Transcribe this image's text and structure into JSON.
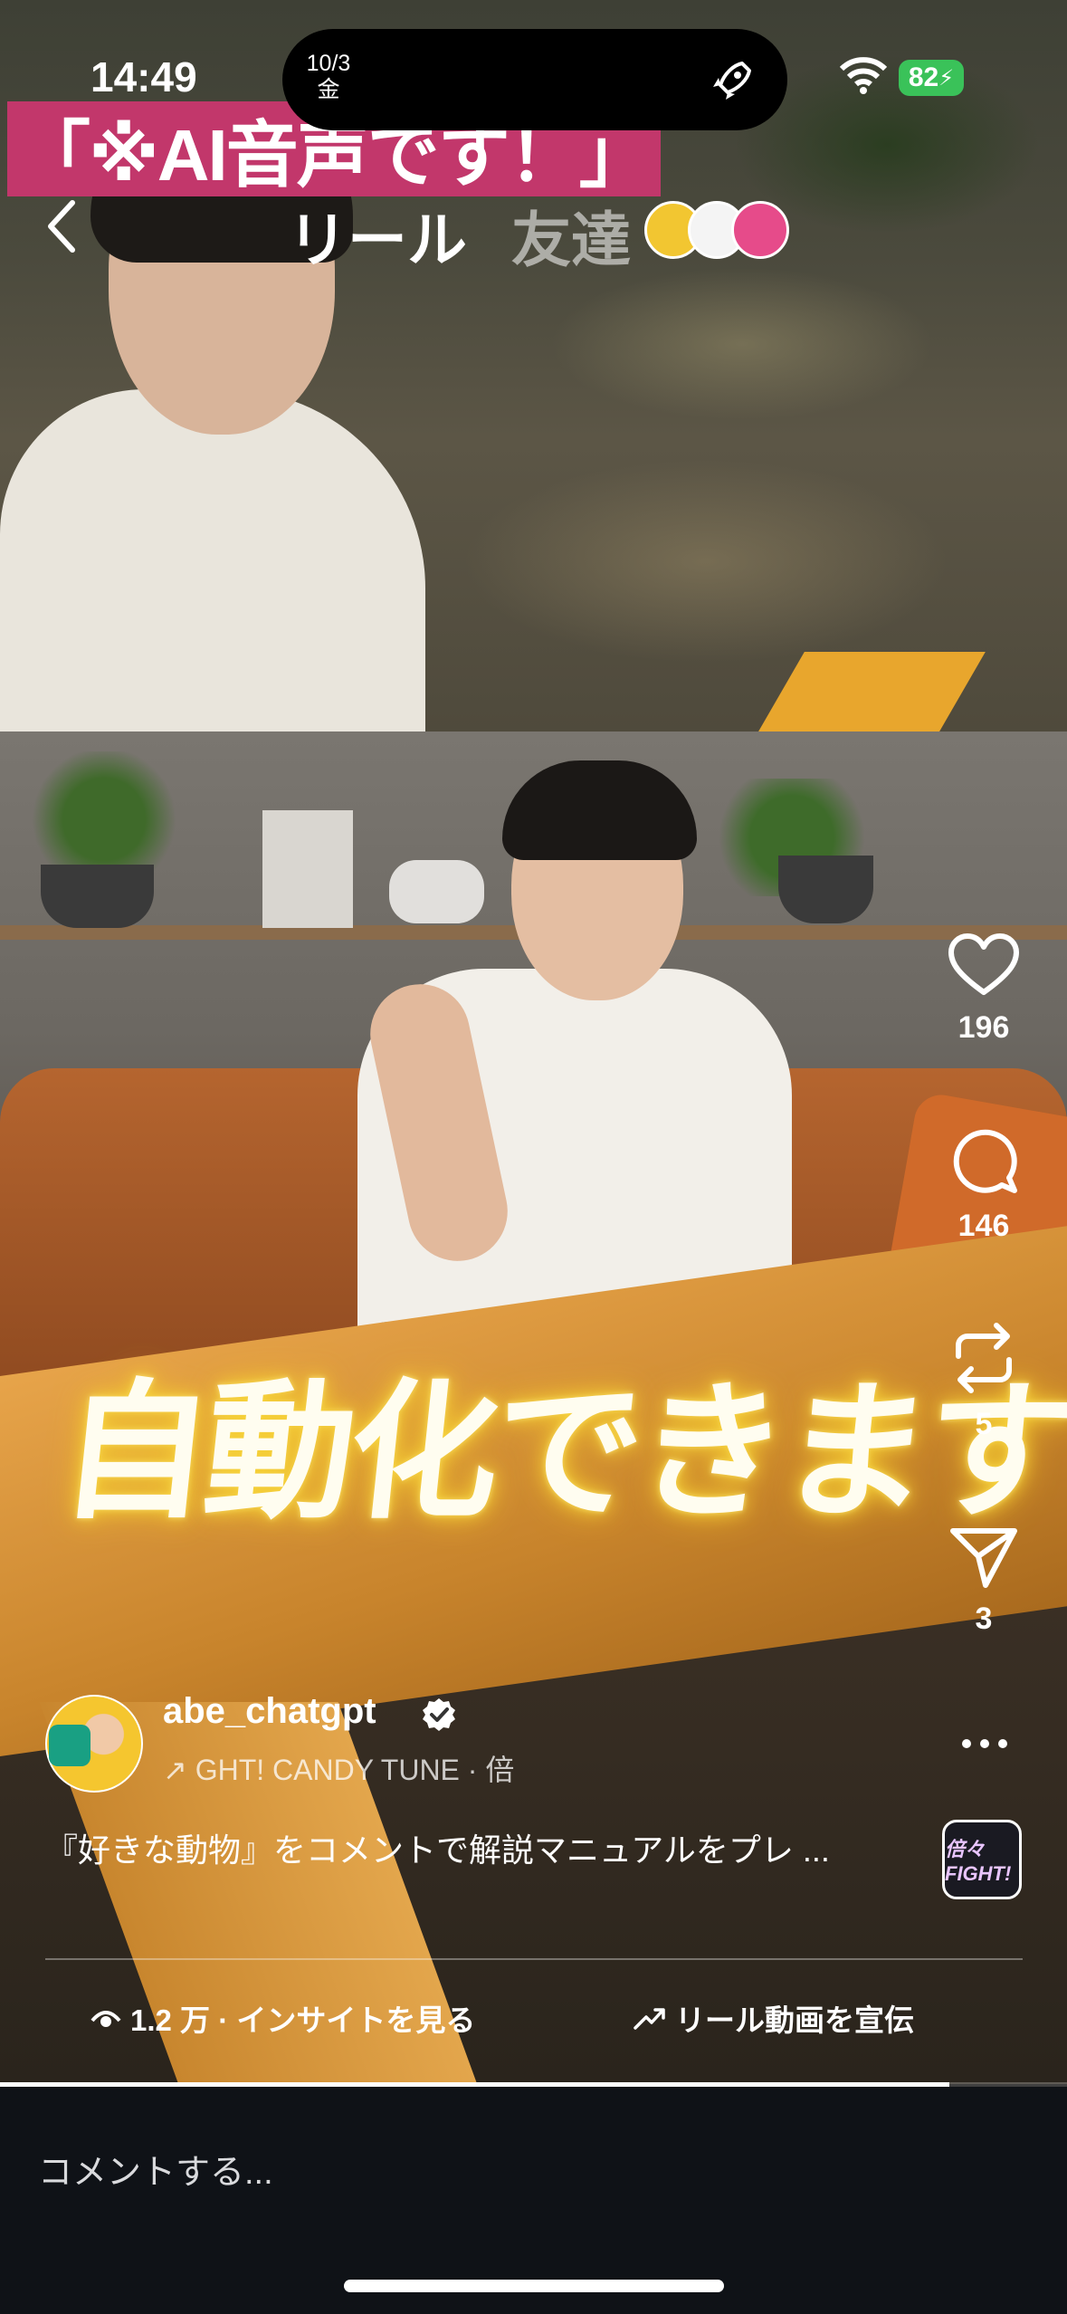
{
  "status_bar": {
    "time": "14:49",
    "date_day": "10/3",
    "date_weekday": "金",
    "battery": "82"
  },
  "overlay": {
    "ai_notice": "「※AI音声です！」",
    "subtitle": "自動化できます"
  },
  "header": {
    "tab_reels": "リール",
    "tab_friends": "友達"
  },
  "actions": {
    "likes": "196",
    "comments": "146",
    "reposts": "5",
    "shares": "3"
  },
  "post": {
    "username": "abe_chatgpt",
    "audio": "GHT!   CANDY TUNE · 倍",
    "description": "『好きな動物』をコメントで解説マニュアルをプレ ...",
    "audio_thumb_label": "倍々FIGHT!"
  },
  "footer": {
    "insights": "1.2 万 · インサイトを見る",
    "promote": "リール動画を宣伝",
    "comment_placeholder": "コメントする...",
    "progress": 0.89
  },
  "colors": {
    "ai_banner": "#c2376b",
    "battery": "#3ac259",
    "subtitle_glow": "#f6d23a"
  }
}
